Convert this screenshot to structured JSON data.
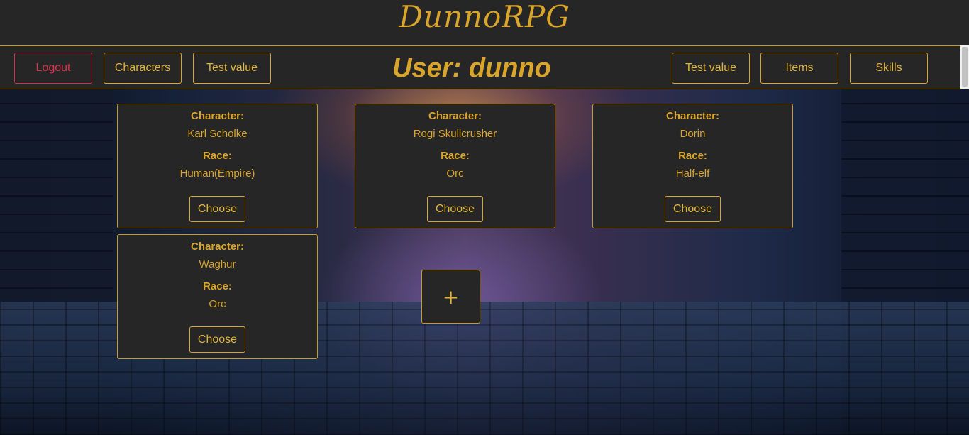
{
  "app": {
    "title": "DunnoRPG"
  },
  "nav": {
    "logout": "Logout",
    "characters": "Characters",
    "test_left": "Test value",
    "user_title": "User: dunno",
    "test_right": "Test value",
    "items": "Items",
    "skills": "Skills"
  },
  "cards": [
    {
      "character_label": "Character:",
      "character": "Karl Scholke",
      "race_label": "Race:",
      "race": "Human(Empire)",
      "choose": "Choose"
    },
    {
      "character_label": "Character:",
      "character": "Rogi Skullcrusher",
      "race_label": "Race:",
      "race": "Orc",
      "choose": "Choose"
    },
    {
      "character_label": "Character:",
      "character": "Dorin",
      "race_label": "Race:",
      "race": "Half-elf",
      "choose": "Choose"
    },
    {
      "character_label": "Character:",
      "character": "Waghur",
      "race_label": "Race:",
      "race": "Orc",
      "choose": "Choose"
    }
  ],
  "add": {
    "label": "+"
  },
  "colors": {
    "accent": "#d9a52a",
    "panel": "#262626",
    "logout": "#d8344c"
  }
}
